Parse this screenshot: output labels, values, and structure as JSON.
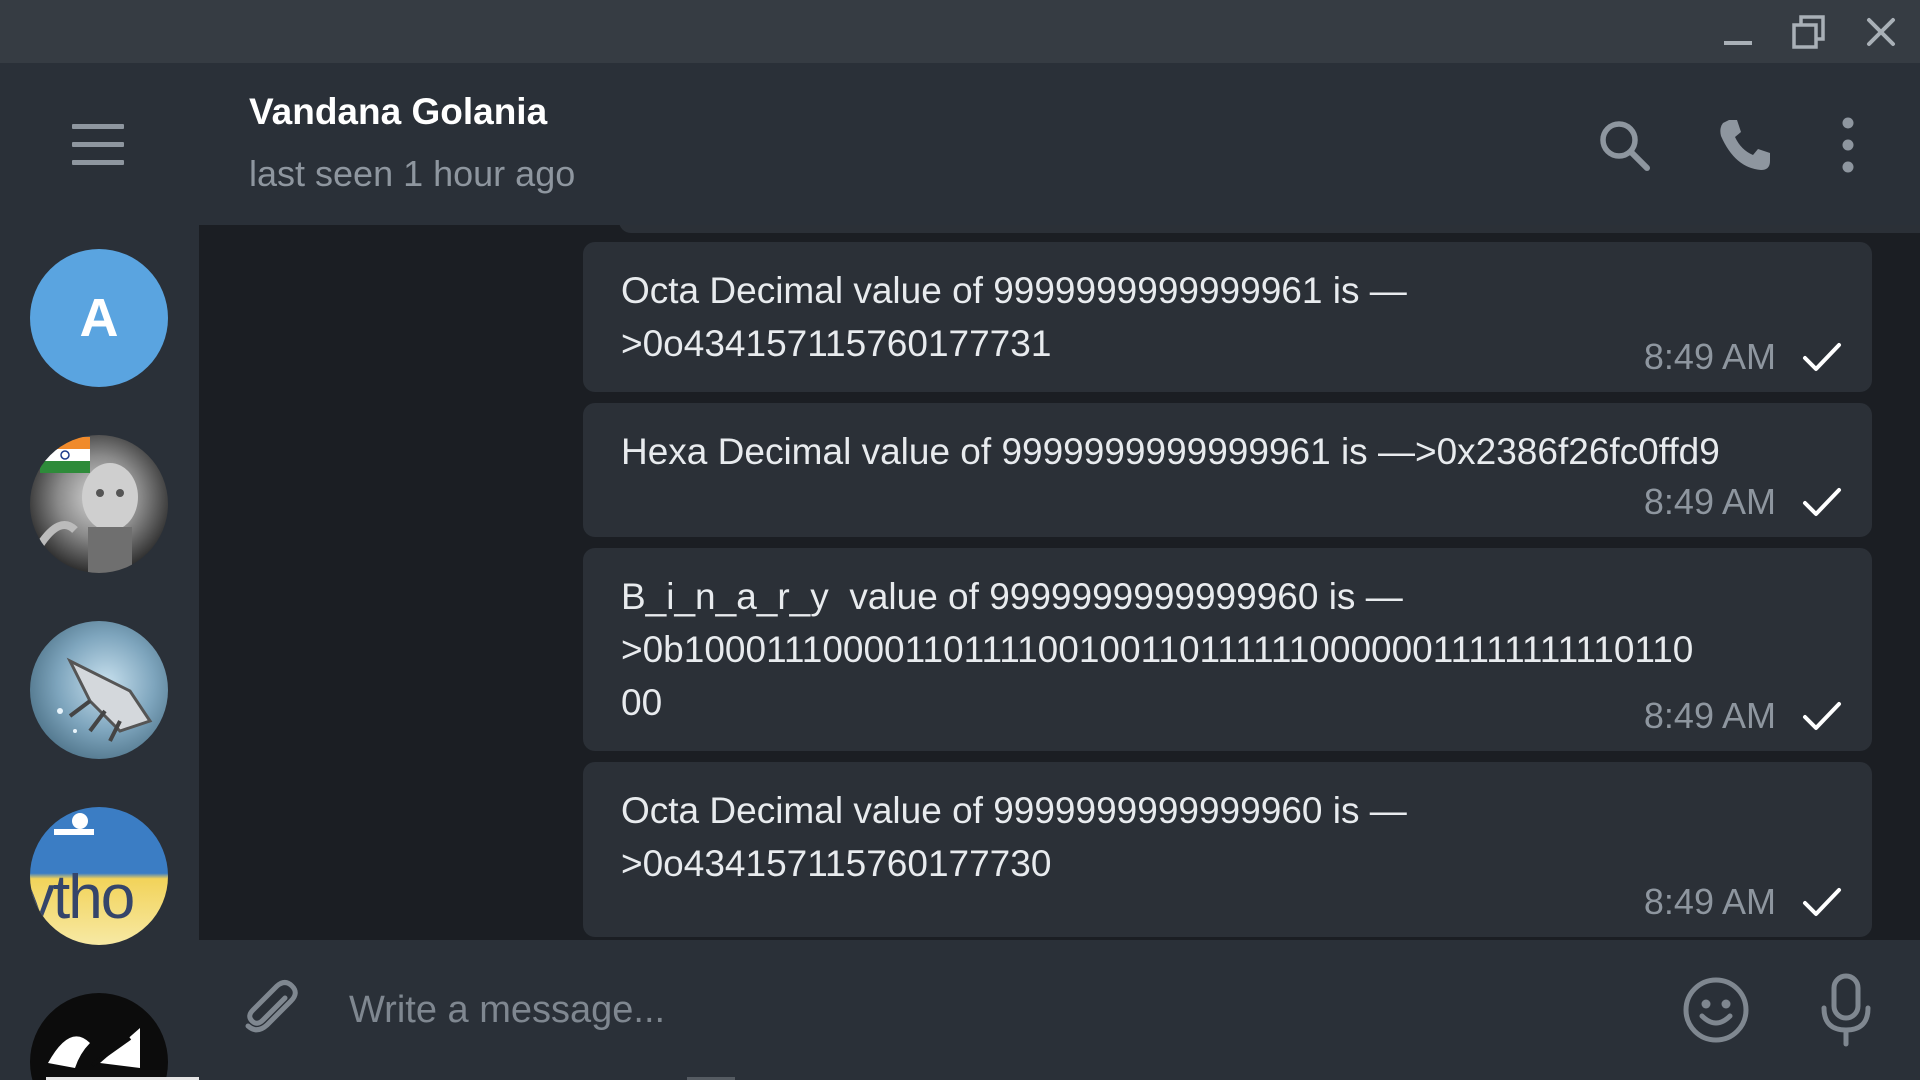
{
  "window": {
    "controls": [
      "minimize-icon",
      "maximize-icon",
      "close-icon"
    ]
  },
  "sidebar": {
    "menu_icon": "hamburger-menu-icon",
    "chats": [
      {
        "initial": "A",
        "color": "#5aa4e0"
      },
      {
        "image": "avatar-robot-flag"
      },
      {
        "image": "avatar-robot-hand"
      },
      {
        "image": "avatar-python",
        "label": "ytho"
      },
      {
        "image": "avatar-dark-logo"
      }
    ]
  },
  "header": {
    "contact_name": "Vandana Golania",
    "status": "last seen 1 hour ago",
    "icons": [
      "search-icon",
      "phone-icon",
      "more-vertical-icon"
    ]
  },
  "messages": [
    {
      "text": "Octa Decimal value of 9999999999999961 is —\n>0o434157115760177731",
      "time": "8:49 AM",
      "status": "sent"
    },
    {
      "text": "Hexa Decimal value of 9999999999999961 is —>0x2386f26fc0ffd9",
      "time": "8:49 AM",
      "status": "sent"
    },
    {
      "text": "B_i_n_a_r_y  value of 9999999999999960 is —\n>0b1000111000011011110010011011111100000011111111110110\n00",
      "time": "8:49 AM",
      "status": "sent"
    },
    {
      "text": "Octa Decimal value of 9999999999999960 is —\n>0o434157115760177730",
      "time": "8:49 AM",
      "status": "sent"
    }
  ],
  "composer": {
    "placeholder": "Write a message...",
    "icons": [
      "paperclip-icon",
      "emoji-icon",
      "microphone-icon"
    ]
  },
  "colors": {
    "background": "#1b1e23",
    "panel": "#2a3038",
    "bubble": "#2b3037",
    "accent_avatar": "#5aa4e0",
    "muted_text": "#8e969f"
  }
}
